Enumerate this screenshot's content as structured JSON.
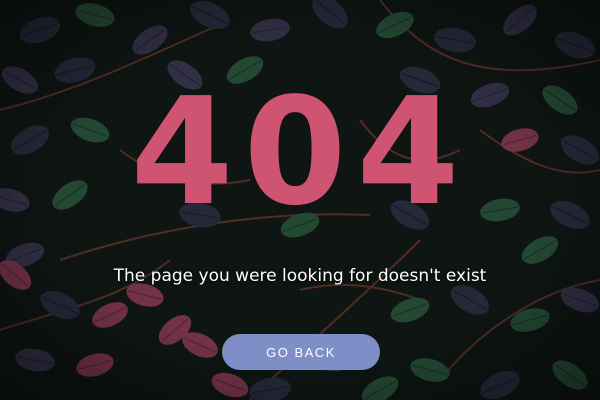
{
  "error": {
    "code": "404",
    "message": "The page you were looking for doesn't exist"
  },
  "actions": {
    "go_back_label": "GO BACK"
  },
  "colors": {
    "code_text": "#cf5471",
    "button_bg": "#7d8fc6",
    "message_text": "#ffffff"
  }
}
